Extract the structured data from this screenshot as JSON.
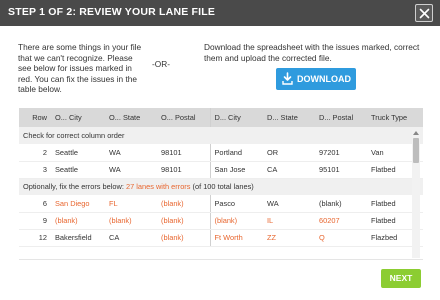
{
  "header": {
    "title": "STEP 1 OF 2: REVIEW YOUR LANE FILE"
  },
  "intro": {
    "left": "There are some things in your file that we can't recognize. Please see below for issues marked in red. You can fix the issues in the table below.",
    "or": "-OR-",
    "right": "Download the spreadsheet with the issues marked, correct them and upload the corrected file.",
    "download_label": "DOWNLOAD"
  },
  "table": {
    "columns": [
      "Row",
      "O... City",
      "O... State",
      "O... Postal",
      "D... City",
      "D... State",
      "D... Postal",
      "Truck Type"
    ],
    "section1": "Check for correct column order",
    "section1_rows": [
      {
        "row": "2",
        "ocity": "Seattle",
        "ostate": "WA",
        "opostal": "98101",
        "dcity": "Portland",
        "dstate": "OR",
        "dpostal": "97201",
        "truck": "Van"
      },
      {
        "row": "3",
        "ocity": "Seattle",
        "ostate": "WA",
        "opostal": "98101",
        "dcity": "San Jose",
        "dstate": "CA",
        "dpostal": "95101",
        "truck": "Flatbed"
      }
    ],
    "section2_prefix": "Optionally, fix the errors below: ",
    "section2_count": "27 lanes with errors",
    "section2_suffix": " (of 100 total lanes)",
    "section2_rows": [
      {
        "row": "6",
        "ocity": "San Diego",
        "ostate": "FL",
        "opostal": "(blank)",
        "dcity": "Pasco",
        "dstate": "WA",
        "dpostal": "(blank)",
        "truck": "Flatbed"
      },
      {
        "row": "9",
        "ocity": "(blank)",
        "ostate": "(blank)",
        "opostal": "(blank)",
        "dcity": "(blank)",
        "dstate": "IL",
        "dpostal": "60207",
        "truck": "Flatbed"
      },
      {
        "row": "12",
        "ocity": "Bakersfield",
        "ostate": "CA",
        "opostal": "(blank)",
        "dcity": "Ft Worth",
        "dstate": "ZZ",
        "dpostal": "Q",
        "truck": "Flazbed"
      }
    ]
  },
  "footer": {
    "next_label": "NEXT"
  },
  "colors": {
    "header_bg": "#4a4a4a",
    "download": "#2f9bde",
    "next": "#8ccd32",
    "error": "#e8662f"
  }
}
